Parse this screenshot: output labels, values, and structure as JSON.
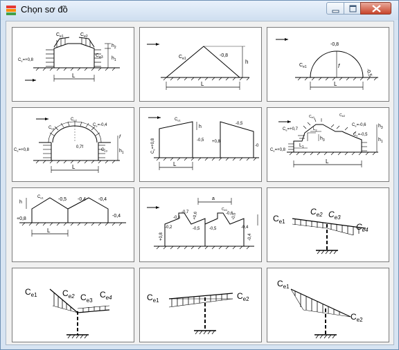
{
  "window": {
    "title": "Chọn sơ đồ"
  },
  "diagrams": {
    "d1": {
      "ce": "C",
      "ce1": "e1",
      "ce2": "e2",
      "ce3": "e3",
      "h1": "h",
      "h1s": "1",
      "h2": "h",
      "h2s": "2",
      "wind": "C",
      "winds": "e",
      "windv": "=+0,8",
      "L": "L"
    },
    "d2": {
      "ce1": "C",
      "ce1s": "e1",
      "v": "-0,8",
      "h": "h",
      "L": "L"
    },
    "d3": {
      "v1": "-0,8",
      "v2": "-0,5",
      "ce1": "C",
      "ce1s": "e1",
      "f": "f",
      "L": "L"
    },
    "d4": {
      "ce1": "C",
      "ce1s": "e1",
      "ce2": "C",
      "ce2s": "e2",
      "ce3": "C",
      "ce3s": "e",
      "v1": "=-0,4",
      "f": "0,7f",
      "wind": "C",
      "winds": "e",
      "windv": "=+0,8",
      "ce3b": "C",
      "ce3bs": "e3",
      "h1": "h",
      "h1s": "1",
      "fl": "f",
      "L": "L"
    },
    "d5": {
      "ce1": "C",
      "ce1s": "e1",
      "h": "h",
      "v1": "-0,5",
      "v2": "-0,5",
      "v3": "+0,8",
      "v4": "-0",
      "wind": "C",
      "winds": "e",
      "windv": "=+0,8",
      "L": "L"
    },
    "d6": {
      "ce1": "C",
      "ce1s": "e1",
      "ce2": "C",
      "ce2s": "e2",
      "v1": "=+0,7",
      "ce3": "C",
      "ce3s": "e",
      "v2": "=-0,6",
      "ce4": "C",
      "ce4s": "e",
      "v3": "=-0,5",
      "wind": "C",
      "winds": "e",
      "windv": "=+0,8",
      "L1": "L",
      "L1s": "1",
      "L2": "L",
      "L2s": "2",
      "h3": "h",
      "h3s": "3",
      "h1": "h",
      "h1s": "1",
      "L": "L"
    },
    "d7": {
      "ce1": "C",
      "ce1s": "e1",
      "v1": "-0,5",
      "v2": "-0,4",
      "v3": "-0,4",
      "v4": "-0,4",
      "v5": "+0,8",
      "h": "h",
      "L": "L"
    },
    "d8": {
      "a": "a",
      "v1": "-0,7",
      "v2": "-0,6",
      "v3": "+0,6",
      "v4": "-0,2",
      "v5": "-0,5",
      "v6": "-0,5",
      "v7": "-0,6",
      "v8": "-0,5",
      "v9": "-0,4",
      "v10": "+0,8",
      "v11": "-0,4",
      "ce1": "C",
      "ce1s": "e1"
    },
    "d9": {
      "ce1": "C",
      "ce1s": "e1",
      "ce2": "C",
      "ce2s": "e2",
      "ce3": "C",
      "ce3s": "e3",
      "ce4": "C",
      "ce4s": "e4"
    },
    "d10": {
      "ce1": "C",
      "ce1s": "e1",
      "ce2": "C",
      "ce2s": "e2",
      "ce3": "C",
      "ce3s": "e3",
      "ce4": "C",
      "ce4s": "e4"
    },
    "d11": {
      "ce1": "C",
      "ce1s": "e1",
      "ce2": "C",
      "ce2s": "e2"
    },
    "d12": {
      "ce1": "C",
      "ce1s": "e1",
      "ce2": "C",
      "ce2s": "e2"
    }
  }
}
